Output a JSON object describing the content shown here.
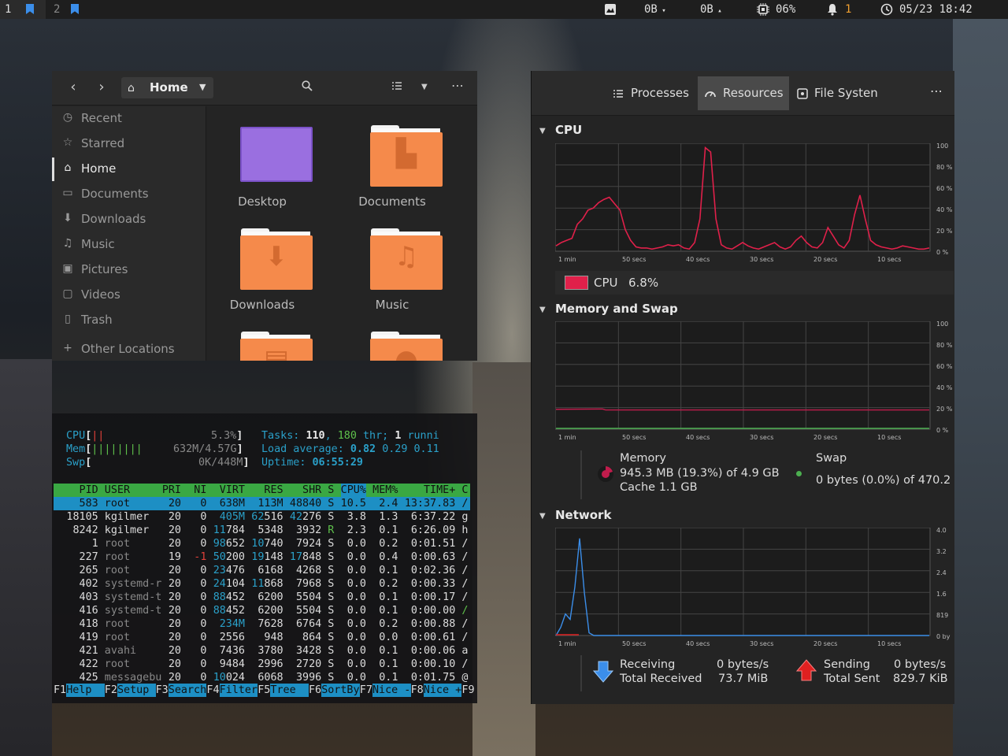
{
  "topbar": {
    "workspaces": [
      {
        "num": "1",
        "active": true
      },
      {
        "num": "2",
        "active": false
      }
    ],
    "net_down": "0B",
    "net_up": "0B",
    "cpu": "06%",
    "notifications": "1",
    "datetime": "05/23 18:42",
    "icons": [
      "monitor-icon",
      "chevron-down-icon",
      "chevron-up-icon",
      "cpu-chip-icon",
      "bell-icon",
      "clock-icon"
    ]
  },
  "files": {
    "path_label": "Home",
    "sidebar": [
      {
        "label": "Recent",
        "icon": "clock-icon",
        "active": false
      },
      {
        "label": "Starred",
        "icon": "star-icon",
        "active": false
      },
      {
        "label": "Home",
        "icon": "home-icon",
        "active": true
      },
      {
        "label": "Documents",
        "icon": "document-icon",
        "active": false
      },
      {
        "label": "Downloads",
        "icon": "download-icon",
        "active": false
      },
      {
        "label": "Music",
        "icon": "music-icon",
        "active": false
      },
      {
        "label": "Pictures",
        "icon": "picture-icon",
        "active": false
      },
      {
        "label": "Videos",
        "icon": "video-icon",
        "active": false
      },
      {
        "label": "Trash",
        "icon": "trash-icon",
        "active": false
      },
      {
        "label": "Other Locations",
        "icon": "plus-icon",
        "active": false
      }
    ],
    "folders": [
      {
        "label": "Desktop",
        "color": "#9a6fe0"
      },
      {
        "label": "Documents",
        "color": "#f58a4b"
      },
      {
        "label": "Downloads",
        "color": "#f58a4b"
      },
      {
        "label": "Music",
        "color": "#f58a4b"
      },
      {
        "label": "",
        "color": "#f58a4b"
      },
      {
        "label": "",
        "color": "#f58a4b"
      }
    ]
  },
  "htop": {
    "cpu_label": "CPU",
    "cpu_bar": "||",
    "cpu_value": "5.3%",
    "mem_label": "Mem",
    "mem_bar": "||||||||",
    "mem_value": "632M/4.57G",
    "swp_label": "Swp",
    "swp_value": "0K/448M",
    "tasks_label": "Tasks:",
    "tasks": "110",
    "threads": "180",
    "thr_label": "thr;",
    "running": "1",
    "running_label": "runni",
    "load_label": "Load average:",
    "load1": "0.82",
    "load5": "0.29",
    "load15": "0.11",
    "uptime_label": "Uptime:",
    "uptime": "06:55:29",
    "columns": [
      "PID",
      "USER",
      "PRI",
      "NI",
      "VIRT",
      "RES",
      "SHR",
      "S",
      "CPU%",
      "MEM%",
      "TIME+",
      "C"
    ],
    "rows": [
      {
        "pid": "583",
        "user": "root",
        "pri": "20",
        "ni": "0",
        "virt": "638M",
        "res": "113M",
        "shr": "48840",
        "s": "S",
        "cpu": "10.5",
        "mem": "2.4",
        "time": "13:37.83",
        "cmd": "/",
        "selected": true
      },
      {
        "pid": "18105",
        "user": "kgilmer",
        "pri": "20",
        "ni": "0",
        "virt": "405M",
        "res": "62516",
        "shr": "42276",
        "s": "S",
        "cpu": "3.8",
        "mem": "1.3",
        "time": "6:37.22",
        "cmd": "g"
      },
      {
        "pid": "8242",
        "user": "kgilmer",
        "pri": "20",
        "ni": "0",
        "virt": "11784",
        "res": "5348",
        "shr": "3932",
        "s": "R",
        "cpu": "2.3",
        "mem": "0.1",
        "time": "6:26.09",
        "cmd": "h"
      },
      {
        "pid": "1",
        "user": "root",
        "pri": "20",
        "ni": "0",
        "virt": "98652",
        "res": "10740",
        "shr": "7924",
        "s": "S",
        "cpu": "0.0",
        "mem": "0.2",
        "time": "0:01.51",
        "cmd": "/"
      },
      {
        "pid": "227",
        "user": "root",
        "pri": "19",
        "ni": "-1",
        "virt": "50200",
        "res": "19148",
        "shr": "17848",
        "s": "S",
        "cpu": "0.0",
        "mem": "0.4",
        "time": "0:00.63",
        "cmd": "/"
      },
      {
        "pid": "265",
        "user": "root",
        "pri": "20",
        "ni": "0",
        "virt": "23476",
        "res": "6168",
        "shr": "4268",
        "s": "S",
        "cpu": "0.0",
        "mem": "0.1",
        "time": "0:02.36",
        "cmd": "/"
      },
      {
        "pid": "402",
        "user": "systemd-r",
        "pri": "20",
        "ni": "0",
        "virt": "24104",
        "res": "11868",
        "shr": "7968",
        "s": "S",
        "cpu": "0.0",
        "mem": "0.2",
        "time": "0:00.33",
        "cmd": "/"
      },
      {
        "pid": "403",
        "user": "systemd-t",
        "pri": "20",
        "ni": "0",
        "virt": "88452",
        "res": "6200",
        "shr": "5504",
        "s": "S",
        "cpu": "0.0",
        "mem": "0.1",
        "time": "0:00.17",
        "cmd": "/"
      },
      {
        "pid": "416",
        "user": "systemd-t",
        "pri": "20",
        "ni": "0",
        "virt": "88452",
        "res": "6200",
        "shr": "5504",
        "s": "S",
        "cpu": "0.0",
        "mem": "0.1",
        "time": "0:00.00",
        "cmd": "/"
      },
      {
        "pid": "418",
        "user": "root",
        "pri": "20",
        "ni": "0",
        "virt": "234M",
        "res": "7628",
        "shr": "6764",
        "s": "S",
        "cpu": "0.0",
        "mem": "0.2",
        "time": "0:00.88",
        "cmd": "/"
      },
      {
        "pid": "419",
        "user": "root",
        "pri": "20",
        "ni": "0",
        "virt": "2556",
        "res": "948",
        "shr": "864",
        "s": "S",
        "cpu": "0.0",
        "mem": "0.0",
        "time": "0:00.61",
        "cmd": "/"
      },
      {
        "pid": "421",
        "user": "avahi",
        "pri": "20",
        "ni": "0",
        "virt": "7436",
        "res": "3780",
        "shr": "3428",
        "s": "S",
        "cpu": "0.0",
        "mem": "0.1",
        "time": "0:00.06",
        "cmd": "a"
      },
      {
        "pid": "422",
        "user": "root",
        "pri": "20",
        "ni": "0",
        "virt": "9484",
        "res": "2996",
        "shr": "2720",
        "s": "S",
        "cpu": "0.0",
        "mem": "0.1",
        "time": "0:00.10",
        "cmd": "/"
      },
      {
        "pid": "425",
        "user": "messagebu",
        "pri": "20",
        "ni": "0",
        "virt": "10024",
        "res": "6068",
        "shr": "3996",
        "s": "S",
        "cpu": "0.0",
        "mem": "0.1",
        "time": "0:01.75",
        "cmd": "@"
      }
    ],
    "fkeys": [
      {
        "key": "F1",
        "label": "Help"
      },
      {
        "key": "F2",
        "label": "Setup"
      },
      {
        "key": "F3",
        "label": "Search"
      },
      {
        "key": "F4",
        "label": "Filter"
      },
      {
        "key": "F5",
        "label": "Tree"
      },
      {
        "key": "F6",
        "label": "SortBy"
      },
      {
        "key": "F7",
        "label": "Nice -"
      },
      {
        "key": "F8",
        "label": "Nice +"
      },
      {
        "key": "F9",
        "label": ""
      }
    ]
  },
  "sysmon": {
    "tabs": [
      {
        "label": "Processes",
        "icon": "list-icon",
        "active": false
      },
      {
        "label": "Resources",
        "icon": "gauge-icon",
        "active": true
      },
      {
        "label": "File Systen",
        "icon": "disk-icon",
        "active": false
      }
    ],
    "menu_icon": "more-icon",
    "cpu_section": {
      "title": "CPU",
      "legend_label": "CPU",
      "legend_value": "6.8%",
      "color": "#e0204a",
      "x_ticks": [
        "1 min",
        "50 secs",
        "40 secs",
        "30 secs",
        "20 secs",
        "10 secs"
      ],
      "y_ticks": [
        "100",
        "80 %",
        "60 %",
        "40 %",
        "20 %",
        "0 %"
      ],
      "values": [
        5,
        8,
        10,
        12,
        25,
        30,
        38,
        40,
        45,
        48,
        50,
        44,
        38,
        20,
        10,
        4,
        3,
        3,
        2,
        3,
        4,
        6,
        5,
        6,
        3,
        2,
        8,
        30,
        96,
        92,
        30,
        6,
        3,
        2,
        5,
        8,
        5,
        3,
        2,
        4,
        6,
        8,
        4,
        2,
        4,
        10,
        14,
        8,
        4,
        3,
        8,
        22,
        14,
        6,
        3,
        10,
        34,
        52,
        30,
        10,
        6,
        4,
        3,
        2,
        3,
        5,
        4,
        3,
        2,
        2,
        3
      ]
    },
    "memory_section": {
      "title": "Memory and Swap",
      "memory_label": "Memory",
      "memory_value": "945.3 MB (19.3%) of 4.9 GB",
      "cache_value": "Cache 1.1 GB",
      "swap_label": "Swap",
      "swap_value": "0 bytes (0.0%) of 470.2",
      "memory_color": "#c01c4c",
      "swap_color": "#4caf50",
      "x_ticks": [
        "1 min",
        "50 secs",
        "40 secs",
        "30 secs",
        "20 secs",
        "10 secs"
      ],
      "y_ticks": [
        "100",
        "80 %",
        "60 %",
        "40 %",
        "20 %",
        "0 %"
      ],
      "memory_percent": 19.3,
      "swap_percent": 0.0
    },
    "network_section": {
      "title": "Network",
      "receiving_label": "Receiving",
      "receiving_value": "0 bytes/s",
      "total_received_label": "Total Received",
      "total_received_value": "73.7 MiB",
      "sending_label": "Sending",
      "sending_value": "0 bytes/s",
      "total_sent_label": "Total Sent",
      "total_sent_value": "829.7 KiB",
      "receive_color": "#3b8eea",
      "send_color": "#e02020",
      "x_ticks": [
        "1 min",
        "50 secs",
        "40 secs",
        "30 secs",
        "20 secs",
        "10 secs"
      ],
      "y_ticks": [
        "4.0",
        "3.2",
        "2.4",
        "1.6",
        "819",
        "0 by"
      ],
      "receive_values": [
        0,
        0.3,
        0.8,
        0.6,
        1.8,
        3.6,
        1.6,
        0.1,
        0,
        0,
        0,
        0,
        0,
        0,
        0,
        0,
        0,
        0,
        0,
        0,
        0,
        0,
        0,
        0,
        0,
        0,
        0,
        0,
        0,
        0,
        0,
        0,
        0,
        0,
        0,
        0,
        0,
        0,
        0,
        0
      ]
    }
  }
}
